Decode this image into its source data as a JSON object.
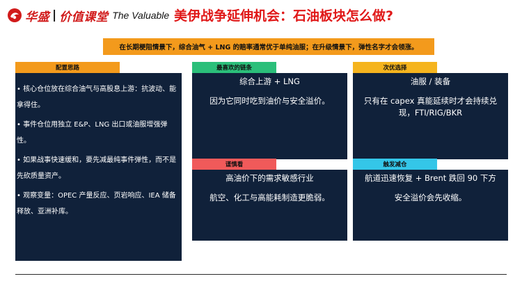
{
  "brand": {
    "name_cn": "华盛",
    "divider": "|",
    "product_cn": "价值课堂",
    "tagline": "The Valuable",
    "logo_icon": "huasheng-logo-mark",
    "color": "#d11b1b"
  },
  "title": "美伊战争延伸机会：石油板块怎么做?",
  "banner": "在长期梗阻情景下，综合油气 + LNG 的赔率通常优于单纯油服；在升级情景下，弹性名字才会领涨。",
  "left": {
    "tab": "配置思路",
    "bullets": [
      "• 核心仓位放在综合油气与高股息上游：抗波动、能拿得住。",
      "• 事件仓位用独立 E&P、LNG 出口或油服增强弹性。",
      "• 如果战事快速缓和，要先减最纯事件弹性，而不是先砍质量资产。",
      "• 观察变量：OPEC 产量反应、页岩响应、IEA 储备释放、亚洲补库。"
    ]
  },
  "panels": {
    "favorite": {
      "tab": "最喜欢的链条",
      "title": "综合上游 + LNG",
      "body": "因为它同时吃到油价与安全溢价。"
    },
    "second": {
      "tab": "次优选择",
      "title": "油服 / 装备",
      "body": "只有在 capex 真能延续时才会持续兑现，FTI/RIG/BKR"
    },
    "caution": {
      "tab": "谨慎看",
      "title": "高油价下的需求敏感行业",
      "body": "航空、化工与高能耗制造更脆弱。"
    },
    "trigger": {
      "tab": "触发减仓",
      "title": "航道迅速恢复 + Brent 跌回 90 下方",
      "body": "安全溢价会先收缩。"
    }
  },
  "colors": {
    "title_red": "#e01818",
    "orange": "#f39a1c",
    "navy": "#10213a",
    "green": "#2bbf7a",
    "yellow": "#f5b41e",
    "red": "#f05a5a",
    "cyan": "#34c6e8"
  }
}
